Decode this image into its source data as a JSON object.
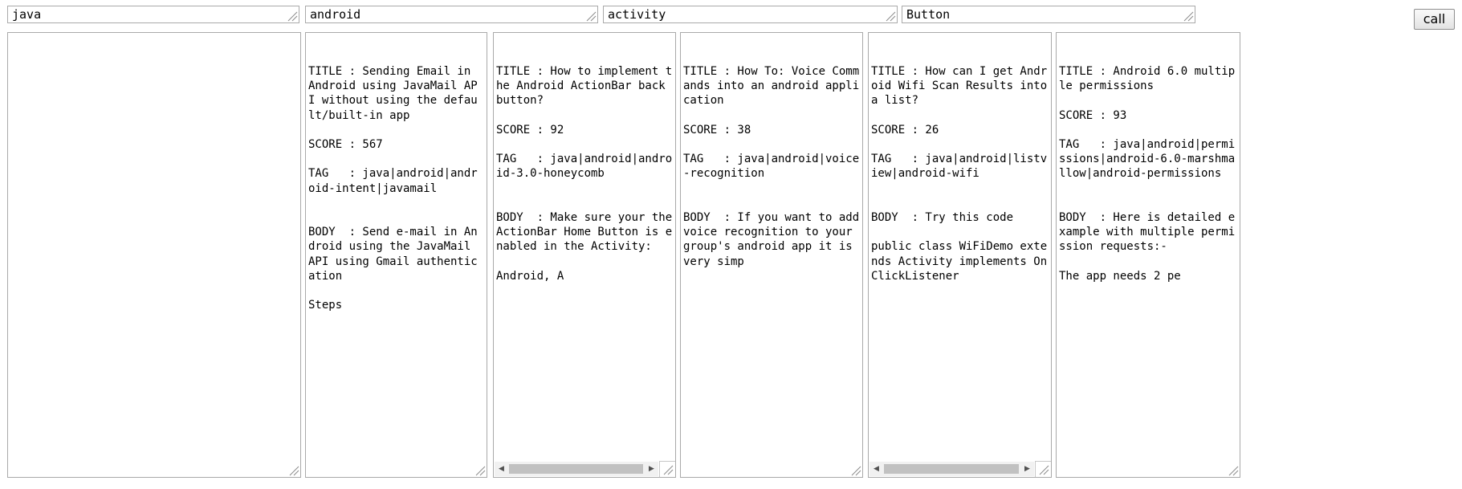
{
  "query_fields": [
    {
      "value": "java"
    },
    {
      "value": "android"
    },
    {
      "value": "activity"
    },
    {
      "value": "Button"
    }
  ],
  "call_button": {
    "label": "call"
  },
  "result_panels": [
    {
      "text": ""
    },
    {
      "text": "TITLE : Sending Email in Android using JavaMail API without using the default/built-in app\n\nSCORE : 567\n\nTAG   : java|android|android-intent|javamail\n\n\nBODY  : Send e-mail in Android using the JavaMail API using Gmail authentication\n\nSteps"
    },
    {
      "text": "TITLE : How to implement the Android ActionBar back button?\n\nSCORE : 92\n\nTAG   : java|android|android-3.0-honeycomb\n\n\nBODY  : Make sure your the ActionBar Home Button is enabled in the Activity:\n\nAndroid, A"
    },
    {
      "text": "TITLE : How To: Voice Commands into an android application\n\nSCORE : 38\n\nTAG   : java|android|voice-recognition\n\n\nBODY  : If you want to add voice recognition to your group's android app it is very simp"
    },
    {
      "text": "TITLE : How can I get Android Wifi Scan Results into a list?\n\nSCORE : 26\n\nTAG   : java|android|listview|android-wifi\n\n\nBODY  : Try this code\n\npublic class WiFiDemo extends Activity implements OnClickListener"
    },
    {
      "text": "TITLE : Android 6.0 multiple permissions\n\nSCORE : 93\n\nTAG   : java|android|permissions|android-6.0-marshmallow|android-permissions\n\n\nBODY  : Here is detailed example with multiple permission requests:-\n\nThe app needs 2 pe"
    }
  ],
  "icons": {
    "resize_grip": "resize-grip-icon",
    "scroll_left": "scroll-left-arrow-icon",
    "scroll_right": "scroll-right-arrow-icon"
  }
}
